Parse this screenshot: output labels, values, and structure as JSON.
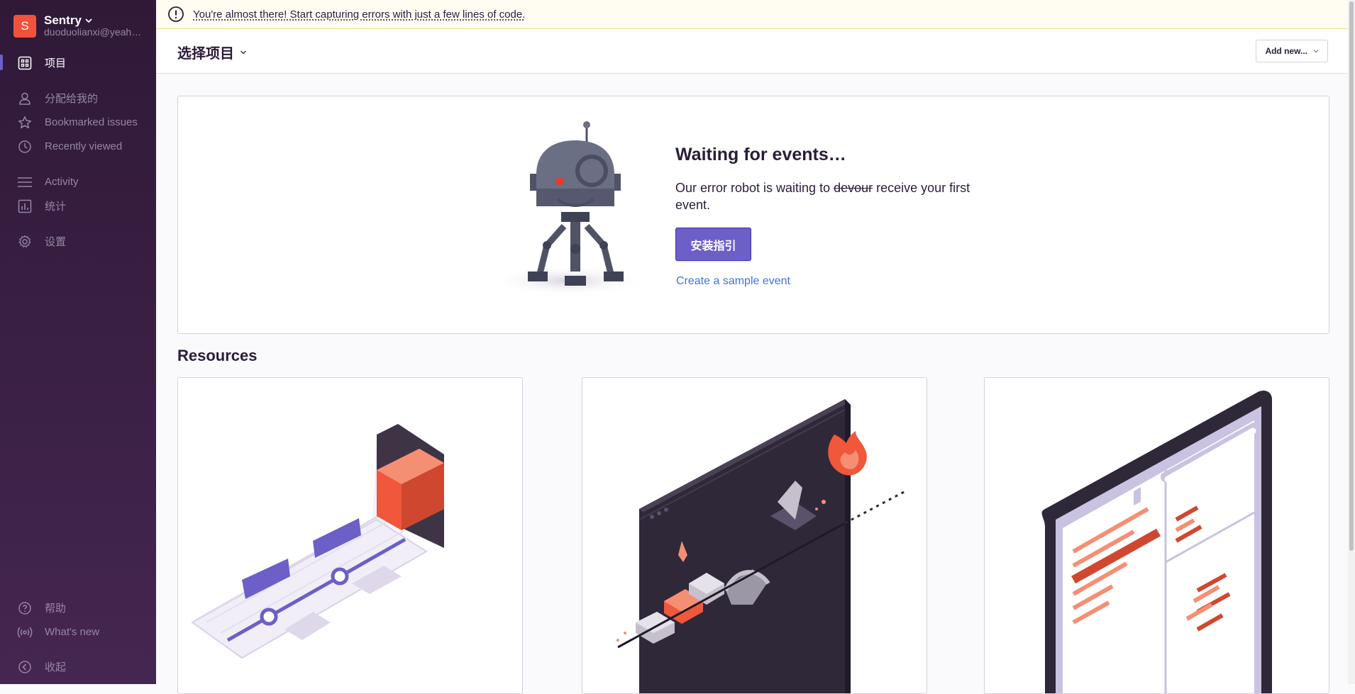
{
  "sidebar": {
    "org_initial": "S",
    "org_name": "Sentry",
    "org_email": "duoduolianxi@yeah.net",
    "items": [
      {
        "label": "项目",
        "icon": "projects-icon",
        "active": true
      },
      {
        "label": "分配给我的",
        "icon": "user-icon"
      },
      {
        "label": "Bookmarked issues",
        "icon": "star-icon"
      },
      {
        "label": "Recently viewed",
        "icon": "clock-icon"
      },
      {
        "label": "Activity",
        "icon": "activity-icon"
      },
      {
        "label": "统计",
        "icon": "stats-icon"
      },
      {
        "label": "设置",
        "icon": "gear-icon"
      }
    ],
    "footer": [
      {
        "label": "帮助",
        "icon": "help-icon"
      },
      {
        "label": "What's new",
        "icon": "broadcast-icon"
      },
      {
        "label": "收起",
        "icon": "collapse-icon"
      }
    ]
  },
  "alert": {
    "text": "You're almost there! Start capturing errors with just a few lines of code."
  },
  "header": {
    "project_select": "选择项目",
    "add_new": "Add new..."
  },
  "waiting": {
    "title": "Waiting for events…",
    "desc_before": "Our error robot is waiting to ",
    "desc_strike": "devour",
    "desc_after": " receive your first event.",
    "install_button": "安装指引",
    "sample_link": "Create a sample event"
  },
  "resources": {
    "title": "Resources"
  },
  "colors": {
    "accent": "#6c5fc7",
    "sidebar_top": "#2f1937",
    "org_avatar": "#f1523c",
    "link": "#3d74db"
  }
}
